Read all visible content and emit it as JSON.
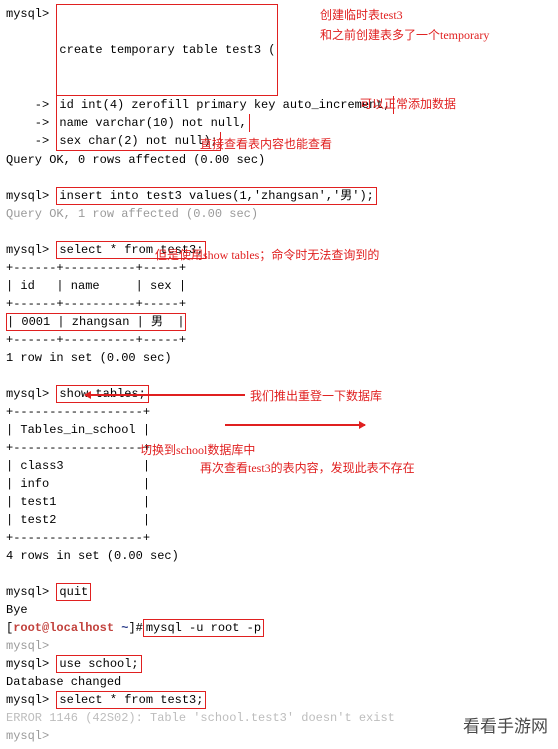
{
  "prompts": {
    "mysql": "mysql>",
    "cont": "    ->",
    "bye": "Bye"
  },
  "create": {
    "l1": "create temporary table test3 (",
    "l2": "id int(4) zerofill primary key auto_increment,",
    "l3": "name varchar(10) not null,",
    "l4": "sex char(2) not null);"
  },
  "query_ok0": "Query OK, 0 rows affected (0.00 sec)",
  "insert_cmd": "insert into test3 values(1,'zhangsan','男');",
  "query_ok1": "Query OK, 1 row affected (0.00 sec)",
  "select_cmd": "select * from test3;",
  "table1": {
    "sep": "+------+----------+-----+",
    "head": "| id   | name     | sex |",
    "row": "| 0001 | zhangsan | 男  |"
  },
  "one_row": "1 row in set (0.00 sec)",
  "show_tables": "show tables;",
  "tables": {
    "sep": "+------------------+",
    "head": "| Tables_in_school |",
    "r1": "| class3           |",
    "r2": "| info             |",
    "r3": "| test1            |",
    "r4": "| test2            |"
  },
  "four_rows": "4 rows in set (0.00 sec)",
  "quit": "quit",
  "root_line": {
    "open": "[",
    "user": "root@localhost",
    "sep": " ",
    "tilde": "~",
    "close": "]",
    "hash": "#",
    "cmd": "mysql -u root -p"
  },
  "use_school": "use school;",
  "db_changed": "Database changed",
  "select2": "select * from test3;",
  "error_line": "ERROR 1146 (42S02): Table 'school.test3' doesn't exist",
  "end_prompt": "mysql>",
  "annotations": {
    "a1a": "创建临时表test3",
    "a1b": "和之前创建表多了一个temporary",
    "a2": "可以正常添加数据",
    "a3": "直接查看表内容也能查看",
    "a4": "但是使用show tables；命令时无法查询到的",
    "a5": "我们推出重登一下数据库",
    "a6": "切换到school数据库中",
    "a7": "再次查看test3的表内容，发现此表不存在"
  },
  "watermark": "看看手游网"
}
